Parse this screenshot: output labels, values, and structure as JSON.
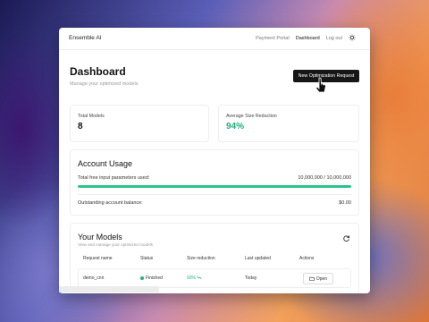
{
  "app": {
    "brand": "Ensemble AI"
  },
  "nav": {
    "items": [
      {
        "label": "Payment Portal",
        "active": false
      },
      {
        "label": "Dashboard",
        "active": true
      },
      {
        "label": "Log out",
        "active": false
      }
    ],
    "theme_icon": "sun-icon"
  },
  "header": {
    "title": "Dashboard",
    "subtitle": "Manage your optimized models",
    "new_button": "New Optimization Request"
  },
  "stats": {
    "total_models": {
      "label": "Total Models",
      "value": "8"
    },
    "avg_reduction": {
      "label": "Average Size Reduction",
      "value": "94%"
    }
  },
  "usage": {
    "title": "Account Usage",
    "params_label": "Total free input parameters used:",
    "params_value": "10,000,000 / 10,000,000",
    "params_fraction": 1.0,
    "balance_label": "Outstanding account balance:",
    "balance_value": "$0.00"
  },
  "models": {
    "title": "Your Models",
    "subtitle": "View and manage your optimized models",
    "refresh_icon": "refresh-icon",
    "columns": [
      "Request name",
      "Status",
      "Size reduction",
      "Last updated",
      "Actions"
    ],
    "rows": [
      {
        "name": "demo_cnn",
        "status": "Finished",
        "reduction": "93%",
        "updated": "Today",
        "action": "Open"
      }
    ]
  },
  "colors": {
    "accent": "#22b07a",
    "button": "#161616"
  }
}
